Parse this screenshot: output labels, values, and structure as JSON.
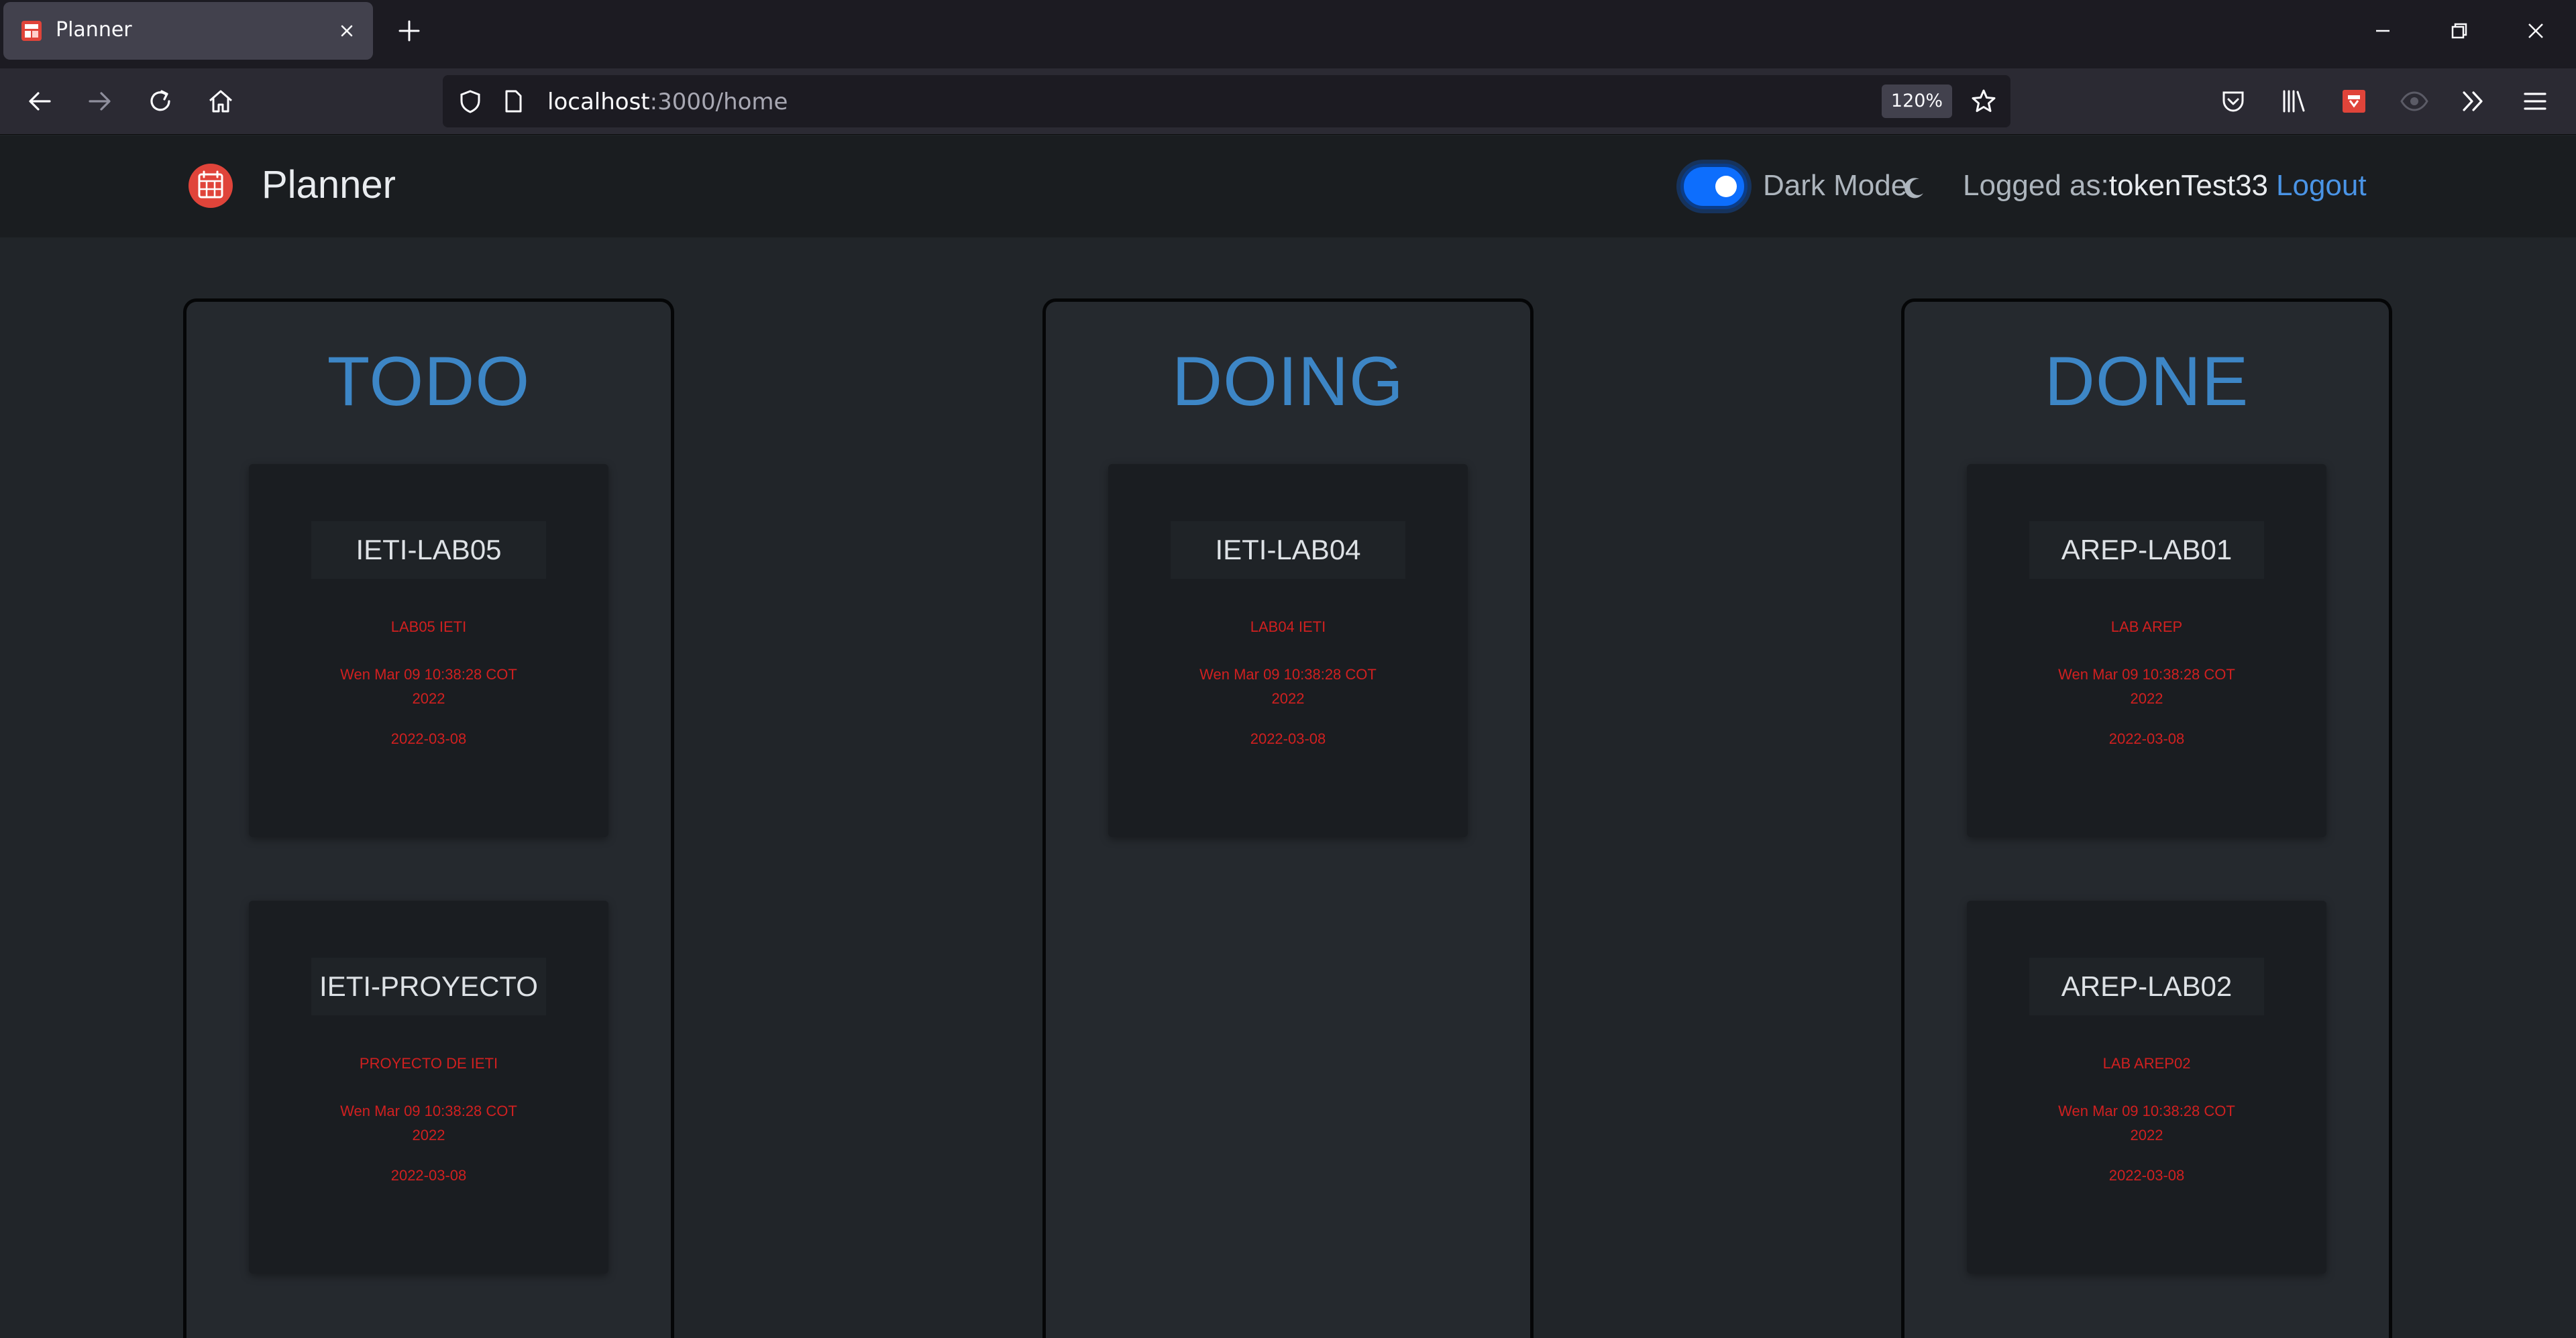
{
  "browser": {
    "tab_title": "Planner",
    "url_host": "localhost",
    "url_path": ":3000/home",
    "zoom": "120%",
    "icons": [
      "shield-icon",
      "page-icon",
      "star-icon",
      "back-icon",
      "forward-icon",
      "reload-icon",
      "home-icon",
      "pocket-icon",
      "library-icon",
      "extension-icon",
      "reader-icon",
      "overflow-icon",
      "menu-icon"
    ]
  },
  "app": {
    "brand": "Planner",
    "dark_mode_label": "Dark Mode",
    "dark_mode_on": true,
    "logged_prefix": "Logged as:",
    "username": "tokenTest33",
    "logout_label": "Logout",
    "colors": {
      "accent": "#3d86c6",
      "card_text": "#d02020",
      "toggle": "#0d6efd",
      "link": "#4a94e6"
    }
  },
  "columns": [
    {
      "title": "TODO",
      "cards": [
        {
          "title": "IETI-LAB05",
          "description": "LAB05 IETI",
          "created": "Wen Mar 09 10:38:28 COT 2022",
          "due": "2022-03-08"
        },
        {
          "title": "IETI-PROYECTO",
          "description": "PROYECTO DE IETI",
          "created": "Wen Mar 09 10:38:28 COT 2022",
          "due": "2022-03-08"
        }
      ]
    },
    {
      "title": "DOING",
      "cards": [
        {
          "title": "IETI-LAB04",
          "description": "LAB04 IETI",
          "created": "Wen Mar 09 10:38:28 COT 2022",
          "due": "2022-03-08"
        }
      ]
    },
    {
      "title": "DONE",
      "cards": [
        {
          "title": "AREP-LAB01",
          "description": "LAB AREP",
          "created": "Wen Mar 09 10:38:28 COT 2022",
          "due": "2022-03-08"
        },
        {
          "title": "AREP-LAB02",
          "description": "LAB AREP02",
          "created": "Wen Mar 09 10:38:28 COT 2022",
          "due": "2022-03-08"
        }
      ]
    }
  ]
}
